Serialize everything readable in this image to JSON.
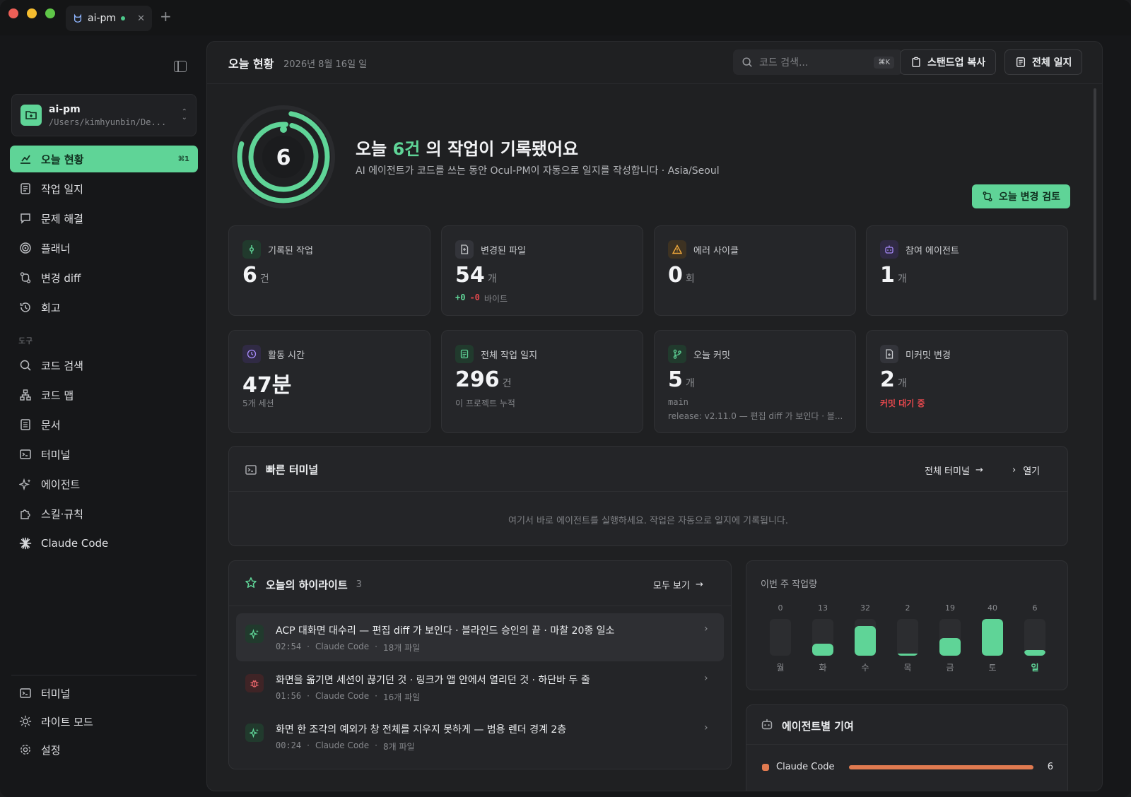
{
  "tab": {
    "title": "ai-pm"
  },
  "sidebar": {
    "project": {
      "name": "ai-pm",
      "path": "/Users/kimhyunbin/De..."
    },
    "items": [
      {
        "label": "오늘 현황",
        "shortcut": "⌘1"
      },
      {
        "label": "작업 일지"
      },
      {
        "label": "문제 해결"
      },
      {
        "label": "플래너"
      },
      {
        "label": "변경 diff"
      },
      {
        "label": "회고"
      }
    ],
    "tools_label": "도구",
    "tools": [
      {
        "label": "코드 검색"
      },
      {
        "label": "코드 맵"
      },
      {
        "label": "문서"
      },
      {
        "label": "터미널"
      },
      {
        "label": "에이전트"
      },
      {
        "label": "스킬·규칙"
      },
      {
        "label": "Claude Code"
      }
    ],
    "bottom": [
      {
        "label": "터미널"
      },
      {
        "label": "라이트 모드"
      },
      {
        "label": "설정"
      }
    ]
  },
  "header": {
    "title": "오늘 현황",
    "date": "2026년 8월 16일 일",
    "search_placeholder": "코드 검색...",
    "search_shortcut": "⌘K",
    "standup_button": "스탠드업 복사",
    "journal_button": "전체 일지"
  },
  "hero": {
    "ring_value": "6",
    "title_prefix": "오늘",
    "title_count": "6건",
    "title_suffix": "의 작업이 기록됐어요",
    "subtitle": "AI 에이전트가 코드를 쓰는 동안 Ocul-PM이 자동으로 일지를 작성합니다 · Asia/Seoul",
    "review_button": "오늘 변경 검토"
  },
  "stats": [
    {
      "label": "기록된 작업",
      "value": "6",
      "unit": "건",
      "sub1": "",
      "sub2": ""
    },
    {
      "label": "변경된 파일",
      "value": "54",
      "unit": "개",
      "added": "+0",
      "removed": "-0",
      "sub_unit": "바이트"
    },
    {
      "label": "에러 사이클",
      "value": "0",
      "unit": "회"
    },
    {
      "label": "참여 에이전트",
      "value": "1",
      "unit": "개"
    },
    {
      "label": "활동 시간",
      "value": "47분",
      "unit": "",
      "sub1": "5개 세션"
    },
    {
      "label": "전체 작업 일지",
      "value": "296",
      "unit": "건",
      "sub1": "이 프로젝트 누적"
    },
    {
      "label": "오늘 커밋",
      "value": "5",
      "unit": "개",
      "sub1": "main",
      "sub2": "release: v2.11.0 — 편집 diff 가 보인다 · 블..."
    },
    {
      "label": "미커밋 변경",
      "value": "2",
      "unit": "개",
      "sub1": "커밋 대기 중"
    }
  ],
  "quick_terminal": {
    "title": "빠른 터미널",
    "all_link": "전체 터미널",
    "open_link": "열기",
    "hint": "여기서 바로 에이전트를 실행하세요. 작업은 자동으로 일지에 기록됩니다."
  },
  "highlights": {
    "title": "오늘의 하이라이트",
    "count": "3",
    "view_all": "모두 보기",
    "items": [
      {
        "title": "ACP 대화면 대수리 — 편집 diff 가 보인다 · 블라인드 승인의 끝 · 마찰 20종 일소",
        "time": "02:54",
        "agent": "Claude Code",
        "files": "18개 파일"
      },
      {
        "title": "화면을 옮기면 세션이 끊기던 것 · 링크가 앱 안에서 열리던 것 · 하단바 두 줄",
        "time": "01:56",
        "agent": "Claude Code",
        "files": "16개 파일"
      },
      {
        "title": "화면 한 조각의 예외가 창 전체를 지우지 못하게 — 범용 렌더 경계 2층",
        "time": "00:24",
        "agent": "Claude Code",
        "files": "8개 파일"
      }
    ]
  },
  "weekly": {
    "title": "이번 주 작업량",
    "days": [
      "월",
      "화",
      "수",
      "목",
      "금",
      "토",
      "일"
    ],
    "values": [
      0,
      13,
      32,
      2,
      19,
      40,
      6
    ],
    "max": 40,
    "today_index": 6
  },
  "agents": {
    "title": "에이전트별 기여",
    "rows": [
      {
        "name": "Claude Code",
        "count": "6",
        "share": 1.0,
        "color": "#e07a50"
      }
    ]
  },
  "colors": {
    "accent": "#5fd497",
    "danger": "#e5484d"
  }
}
